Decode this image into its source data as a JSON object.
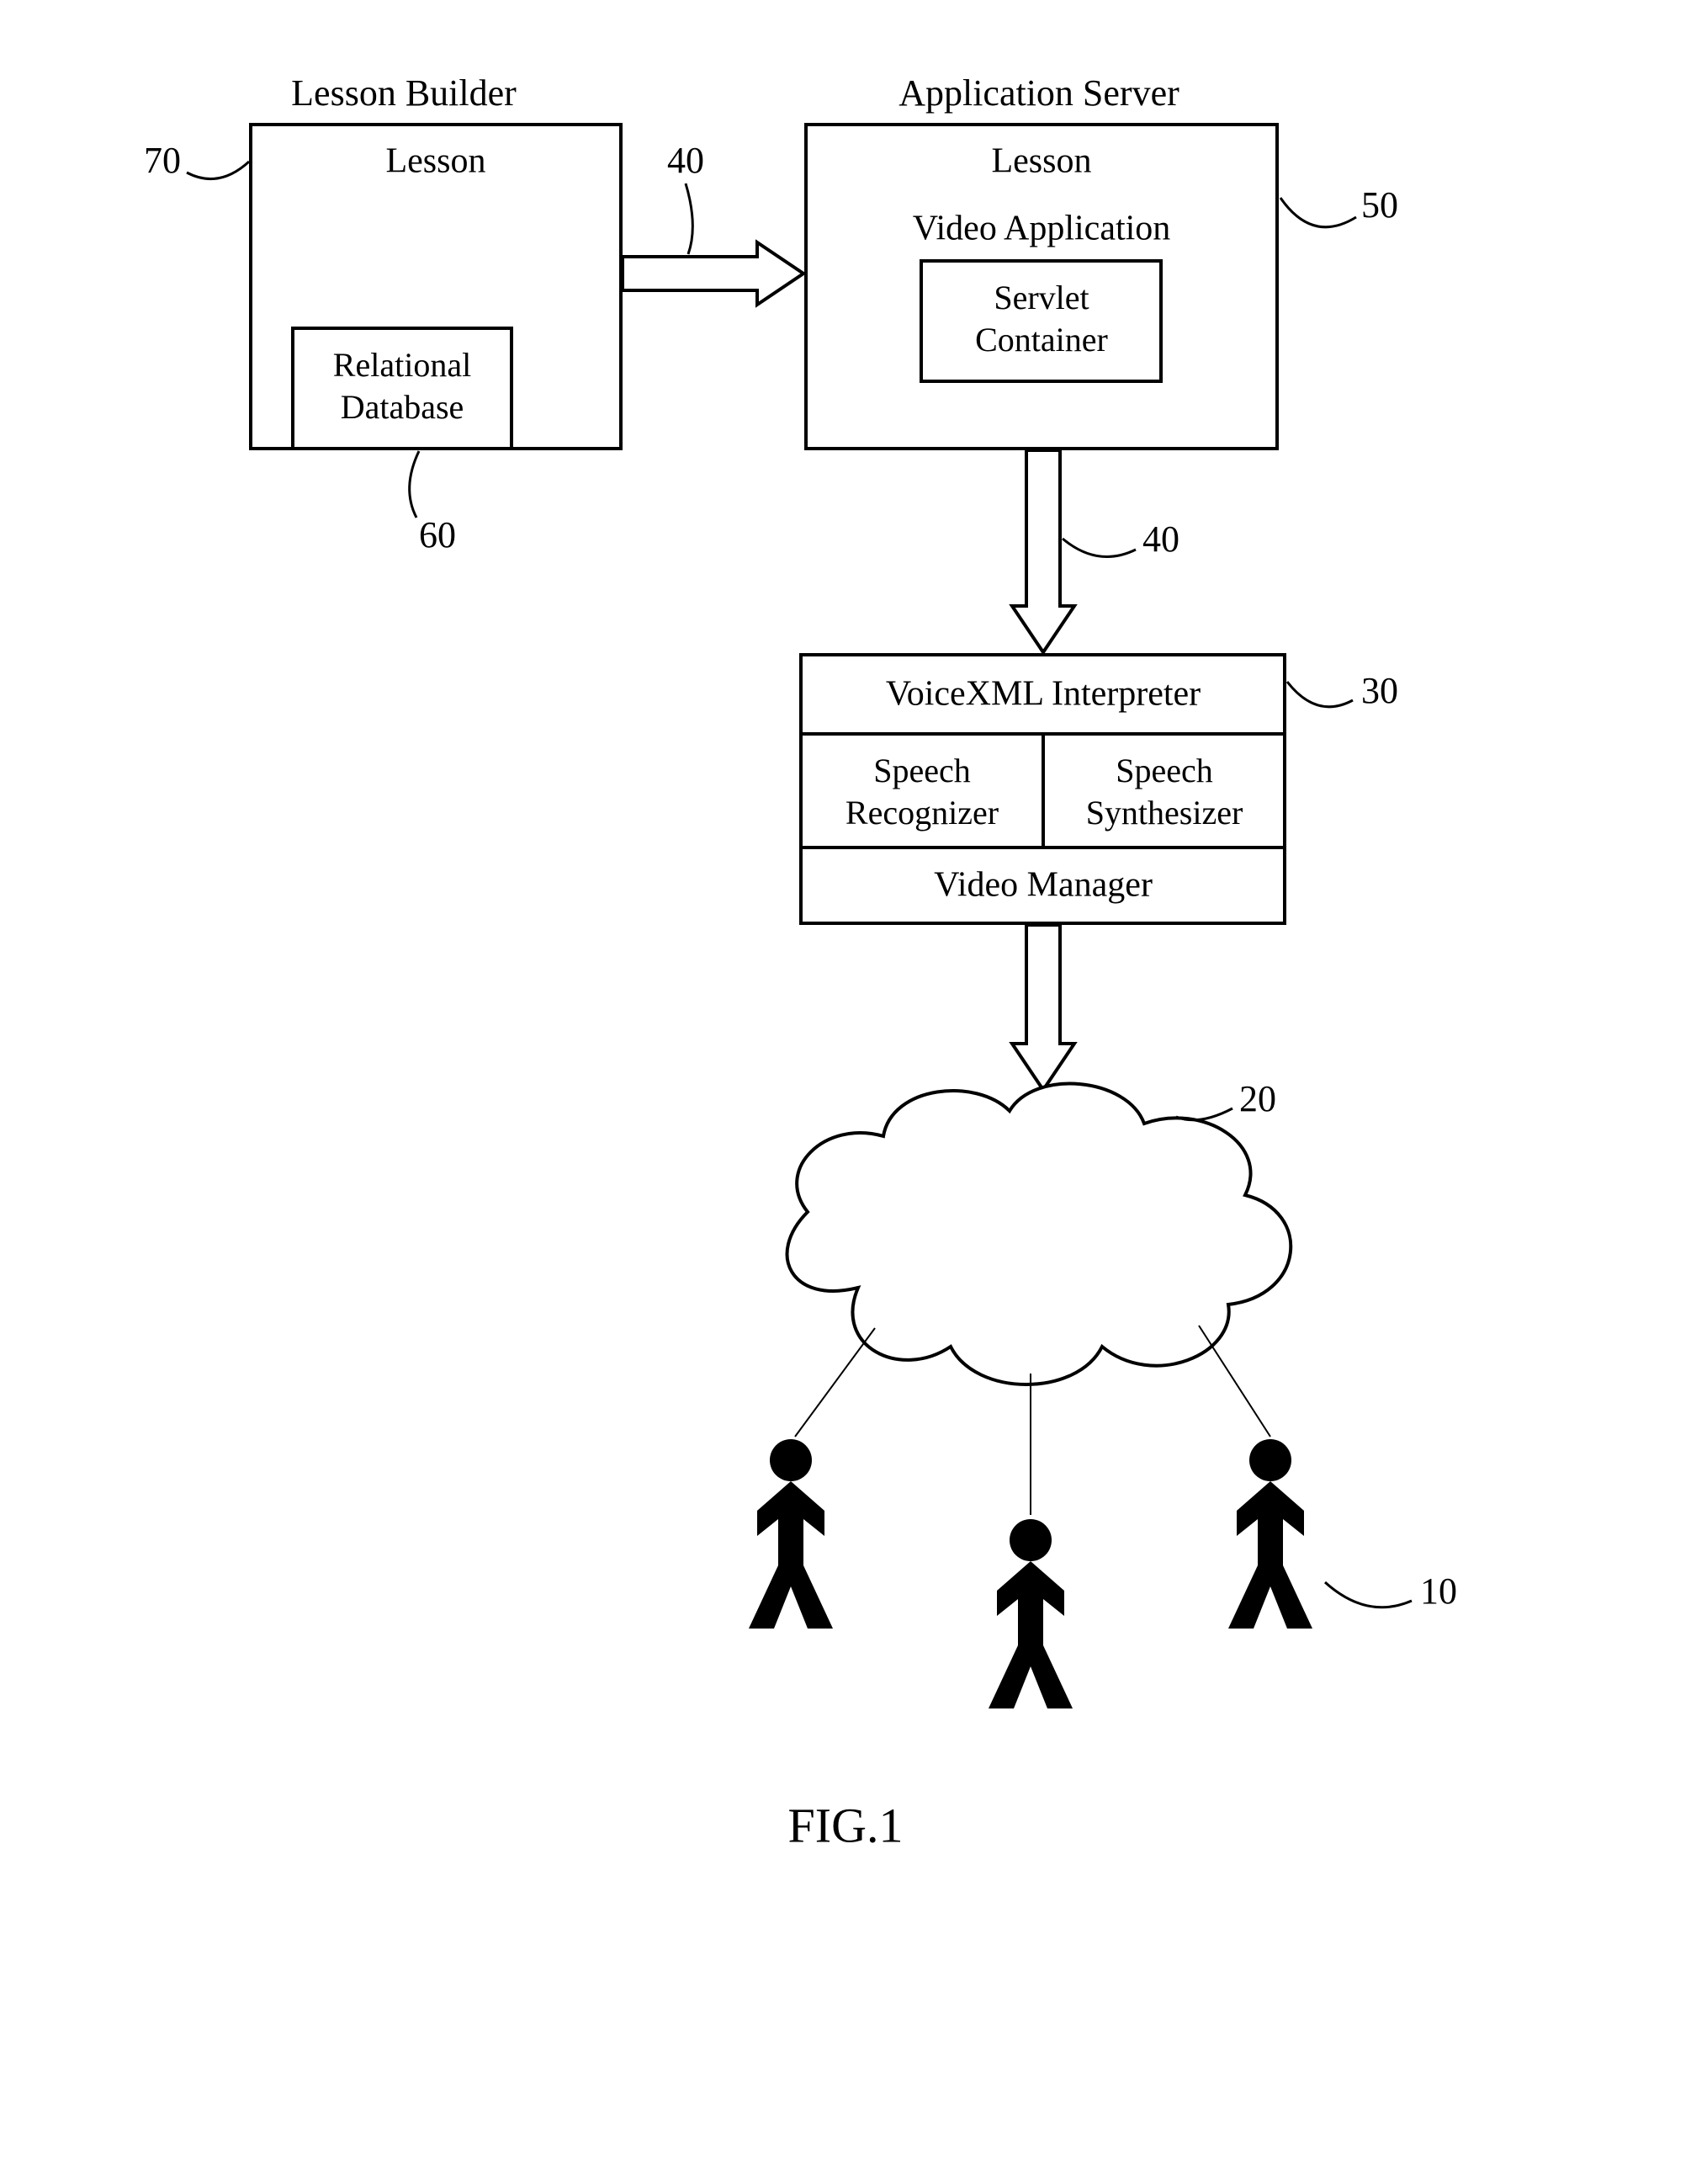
{
  "headers": {
    "lesson_builder": "Lesson Builder",
    "application_server": "Application Server"
  },
  "lesson_builder_box": {
    "lesson": "Lesson",
    "sub": {
      "line1": "Relational",
      "line2": "Database"
    }
  },
  "application_server_box": {
    "lesson": "Lesson",
    "video_app": "Video Application",
    "sub": {
      "line1": "Servlet",
      "line2": "Container"
    }
  },
  "voice_block": {
    "interpreter": "VoiceXML Interpreter",
    "speech_recognizer_l1": "Speech",
    "speech_recognizer_l2": "Recognizer",
    "speech_synthesizer_l1": "Speech",
    "speech_synthesizer_l2": "Synthesizer",
    "video_manager": "Video Manager"
  },
  "refs": {
    "r10": "10",
    "r20": "20",
    "r30": "30",
    "r40a": "40",
    "r40b": "40",
    "r50": "50",
    "r60": "60",
    "r70": "70"
  },
  "figure": "FIG.1"
}
